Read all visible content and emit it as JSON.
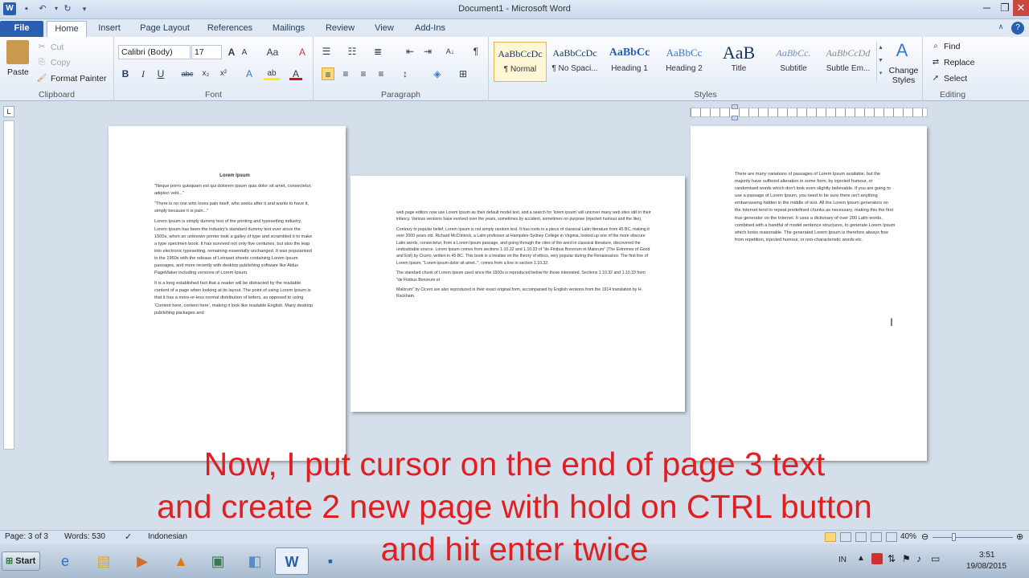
{
  "window": {
    "title": "Document1 - Microsoft Word",
    "minimize": "─",
    "maximize": "❐",
    "close": "✕"
  },
  "tabs": {
    "file": "File",
    "home": "Home",
    "insert": "Insert",
    "page_layout": "Page Layout",
    "references": "References",
    "mailings": "Mailings",
    "review": "Review",
    "view": "View",
    "addins": "Add-Ins"
  },
  "clipboard": {
    "paste": "Paste",
    "cut": "Cut",
    "copy": "Copy",
    "format_painter": "Format Painter",
    "label": "Clipboard"
  },
  "font": {
    "name": "Calibri (Body)",
    "size": "17",
    "label": "Font",
    "bold": "B",
    "italic": "I",
    "underline": "U",
    "strike": "abc",
    "sub": "x₂",
    "sup": "x²",
    "grow": "A",
    "shrink": "A",
    "case": "Aa",
    "clear": "A",
    "highlight": "ab",
    "color": "A",
    "effects": "A"
  },
  "paragraph": {
    "label": "Paragraph",
    "pilcrow": "¶",
    "sort": "A↓"
  },
  "styles": {
    "label": "Styles",
    "items": [
      {
        "preview": "AaBbCcDc",
        "name": "¶ Normal"
      },
      {
        "preview": "AaBbCcDc",
        "name": "¶ No Spaci..."
      },
      {
        "preview": "AaBbCc",
        "name": "Heading 1"
      },
      {
        "preview": "AaBbCc",
        "name": "Heading 2"
      },
      {
        "preview": "AaB",
        "name": "Title"
      },
      {
        "preview": "AaBbCc.",
        "name": "Subtitle"
      },
      {
        "preview": "AaBbCcDd",
        "name": "Subtle Em..."
      }
    ],
    "change": "Change Styles"
  },
  "editing": {
    "label": "Editing",
    "find": "Find",
    "replace": "Replace",
    "select": "Select"
  },
  "pages": {
    "p1": {
      "title": "Lorem Ipsum",
      "paras": [
        "\"Neque porro quisquam est qui dolorem ipsum quia dolor sit amet, consectetur, adipisci velit...\"",
        "\"There is no one who loves pain itself, who seeks after it and wants to have it, simply because it is pain...\"",
        "Lorem Ipsum is simply dummy text of the printing and typesetting industry. Lorem Ipsum has been the industry's standard dummy text ever since the 1500s, when an unknown printer took a galley of type and scrambled it to make a type specimen book. It has survived not only five centuries, but also the leap into electronic typesetting, remaining essentially unchanged. It was popularised in the 1960s with the release of Letraset sheets containing Lorem Ipsum passages, and more recently with desktop publishing software like Aldus PageMaker including versions of Lorem Ipsum.",
        "It is a long established fact that a reader will be distracted by the readable content of a page when looking at its layout. The point of using Lorem Ipsum is that it has a more-or-less normal distribution of letters, as opposed to using 'Content here, content here', making it look like readable English. Many desktop publishing packages and"
      ]
    },
    "p2": {
      "paras": [
        "web page editors now use Lorem Ipsum as their default model text, and a search for 'lorem ipsum' will uncover many web sites still in their infancy. Various versions have evolved over the years, sometimes by accident, sometimes on purpose (injected humour and the like).",
        "Contrary to popular belief, Lorem Ipsum is not simply random text. It has roots in a piece of classical Latin literature from 45 BC, making it over 2000 years old. Richard McClintock, a Latin professor at Hampden-Sydney College in Virginia, looked up one of the more obscure Latin words, consectetur, from a Lorem Ipsum passage, and going through the cites of the word in classical literature, discovered the undoubtable source. Lorem Ipsum comes from sections 1.10.32 and 1.10.33 of \"de Finibus Bonorum et Malorum\" (The Extremes of Good and Evil) by Cicero, written in 45 BC. This book is a treatise on the theory of ethics, very popular during the Renaissance. The first line of Lorem Ipsum, \"Lorem ipsum dolor sit amet..\", comes from a line in section 1.10.32.",
        "The standard chunk of Lorem Ipsum used since the 1500s is reproduced below for those interested. Sections 1.10.32 and 1.10.33 from \"de Finibus Bonorum et",
        "Malorum\" by Cicero are also reproduced in their exact original form, accompanied by English versions from the 1914 translation by H. Rackham."
      ]
    },
    "p3": {
      "paras": [
        "There are many variations of passages of Lorem Ipsum available, but the majority have suffered alteration in some form, by injected humour, or randomised words which don't look even slightly believable. If you are going to use a passage of Lorem Ipsum, you need to be sure there isn't anything embarrassing hidden in the middle of text. All the Lorem Ipsum generators on the Internet tend to repeat predefined chunks as necessary, making this the first true generator on the Internet. It uses a dictionary of over 200 Latin words, combined with a handful of model sentence structures, to generate Lorem Ipsum which looks reasonable. The generated Lorem Ipsum is therefore always free from repetition, injected humour, or non-characteristic words etc."
      ]
    }
  },
  "status": {
    "page": "Page: 3 of 3",
    "words": "Words: 530",
    "language": "Indonesian",
    "zoom": "40%"
  },
  "caption": {
    "line1": "Now, I put cursor on the end of page 3 text",
    "line2": "and create 2 new page with hold on CTRL button",
    "line3": "and hit enter twice"
  },
  "taskbar": {
    "start": "Start",
    "lang": "IN",
    "time": "3:51",
    "date": "19/08/2015"
  },
  "colors": {
    "caption": "#e02020",
    "file_tab": "#2a5fb0"
  }
}
